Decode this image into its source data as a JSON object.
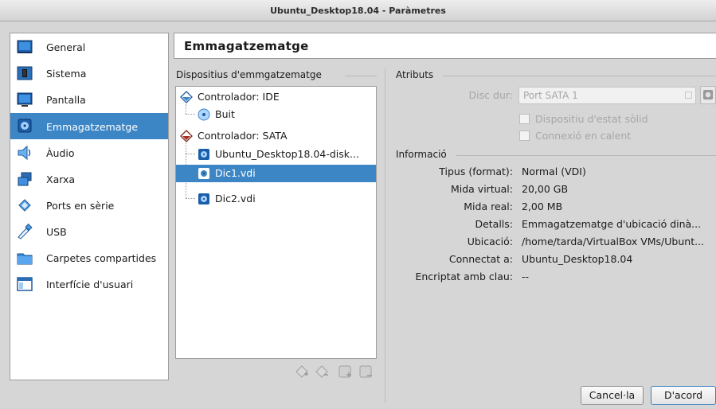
{
  "window": {
    "title": "Ubuntu_Desktop18.04 - Paràmetres"
  },
  "sidebar": {
    "items": [
      {
        "label": "General",
        "icon": "general-icon"
      },
      {
        "label": "Sistema",
        "icon": "system-chip-icon"
      },
      {
        "label": "Pantalla",
        "icon": "display-monitor-icon"
      },
      {
        "label": "Emmagatzematge",
        "icon": "storage-disk-icon",
        "selected": true
      },
      {
        "label": "Àudio",
        "icon": "speaker-icon"
      },
      {
        "label": "Xarxa",
        "icon": "network-icon"
      },
      {
        "label": "Ports en sèrie",
        "icon": "serial-port-icon"
      },
      {
        "label": "USB",
        "icon": "usb-icon"
      },
      {
        "label": "Carpetes compartides",
        "icon": "shared-folder-icon"
      },
      {
        "label": "Interfície d'usuari",
        "icon": "user-interface-icon"
      }
    ]
  },
  "header": {
    "title": "Emmagatzematge"
  },
  "devices": {
    "group_title": "Dispositius d'emmgatzematge",
    "controllers": [
      {
        "label": "Controlador: IDE",
        "children": [
          {
            "label": "Buit",
            "kind": "optical"
          }
        ]
      },
      {
        "label": "Controlador: SATA",
        "children": [
          {
            "label": "Ubuntu_Desktop18.04-disk...",
            "kind": "disk"
          },
          {
            "label": "Dic1.vdi",
            "kind": "disk",
            "selected": true
          },
          {
            "label": "Dic2.vdi",
            "kind": "disk"
          }
        ]
      }
    ],
    "toolbar": [
      "add-controller-icon",
      "remove-controller-icon",
      "add-attachment-icon",
      "remove-attachment-icon"
    ]
  },
  "attributes": {
    "group_title": "Atributs",
    "hard_disk_label": "Disc dur:",
    "hard_disk_value": "Port SATA 1",
    "ssd_label": "Dispositiu d'estat sòlid",
    "hotplug_label": "Connexió en calent"
  },
  "information": {
    "group_title": "Informació",
    "rows": [
      {
        "label": "Tipus (format):",
        "value": "Normal (VDI)"
      },
      {
        "label": "Mida virtual:",
        "value": "20,00 GB"
      },
      {
        "label": "Mida real:",
        "value": "2,00 MB"
      },
      {
        "label": "Detalls:",
        "value": "Emmagatzematge d'ubicació dinà..."
      },
      {
        "label": "Ubicació:",
        "value": "/home/tarda/VirtualBox VMs/Ubunt..."
      },
      {
        "label": "Connectat a:",
        "value": "Ubuntu_Desktop18.04"
      },
      {
        "label": "Encriptat amb clau:",
        "value": "--"
      }
    ]
  },
  "buttons": {
    "cancel": "Cancel·la",
    "ok": "D'acord"
  },
  "colors": {
    "selection": "#3c86c6",
    "window_bg": "#d6d6d6"
  }
}
